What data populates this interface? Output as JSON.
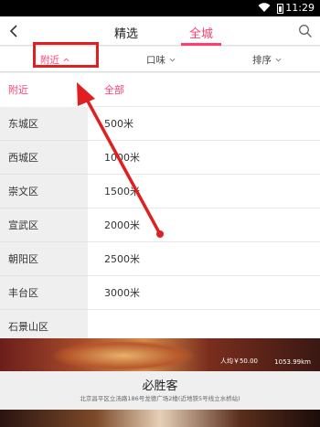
{
  "status_bar": {
    "time": "11:29"
  },
  "nav": {
    "tab_featured": "精选",
    "tab_citywide": "全城"
  },
  "filters": {
    "nearby": "附近",
    "taste": "口味",
    "sort": "排序"
  },
  "districts": [
    {
      "label": "附近",
      "active": true
    },
    {
      "label": "东城区",
      "active": false
    },
    {
      "label": "西城区",
      "active": false
    },
    {
      "label": "崇文区",
      "active": false
    },
    {
      "label": "宣武区",
      "active": false
    },
    {
      "label": "朝阳区",
      "active": false
    },
    {
      "label": "丰台区",
      "active": false
    },
    {
      "label": "石景山区",
      "active": false
    }
  ],
  "distances": [
    {
      "label": "全部",
      "active": true
    },
    {
      "label": "500米",
      "active": false
    },
    {
      "label": "1000米",
      "active": false
    },
    {
      "label": "1500米",
      "active": false
    },
    {
      "label": "2000米",
      "active": false
    },
    {
      "label": "2500米",
      "active": false
    },
    {
      "label": "3000米",
      "active": false
    }
  ],
  "listing": {
    "price": "人均￥50.00",
    "distance": "1053.99km",
    "name": "必胜客",
    "address": "北京昌平区立汤路186号龙德广场2楼(近地铁5号线立水桥站)"
  },
  "colors": {
    "accent": "#ff3e70",
    "annotation": "#e02020"
  }
}
